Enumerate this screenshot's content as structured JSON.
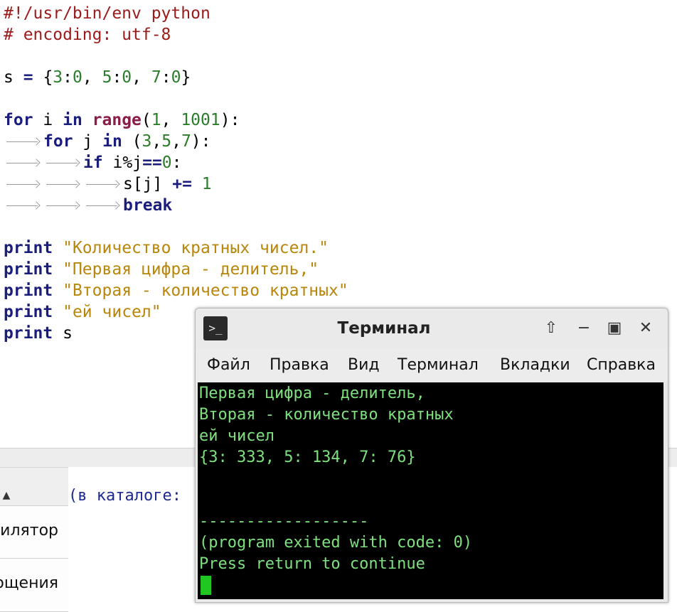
{
  "editor": {
    "lines": {
      "shebang": "#!/usr/bin/env python",
      "encoding": "# encoding: utf-8",
      "s_name": "s",
      "s_eq": "=",
      "s_open": "{",
      "s_k1": "3",
      "s_c1": ":",
      "s_v1": "0",
      "s_sep1": ", ",
      "s_k2": "5",
      "s_c2": ":",
      "s_v2": "0",
      "s_sep2": ", ",
      "s_k3": "7",
      "s_c3": ":",
      "s_v3": "0",
      "s_close": "}",
      "for1_kw": "for",
      "for1_var": " i ",
      "for1_in": "in",
      "for1_range": "range",
      "for1_open": "(",
      "for1_a": "1",
      "for1_sep": ", ",
      "for1_b": "1001",
      "for1_close": "):",
      "for2_kw": "for",
      "for2_var": " j ",
      "for2_in": "in",
      "for2_open": " (",
      "for2_a": "3",
      "for2_c1": ",",
      "for2_b": "5",
      "for2_c2": ",",
      "for2_c": "7",
      "for2_close": "):",
      "if_kw": "if",
      "if_expr": " i%j",
      "if_op": "==",
      "if_num": "0",
      "if_colon": ":",
      "inc_target": "s[j] ",
      "inc_op": "+=",
      "inc_num": " 1",
      "break_kw": "break",
      "print_kw": "print",
      "print1_str": "\"Количество кратных чисел.\"",
      "print2_str": "\"Первая цифра - делитель,\"",
      "print3_str": "\"Вторая - количество кратных\"",
      "print4_str": "\"ей чисел\"",
      "print5_arg": " s"
    }
  },
  "bottom_panel": {
    "side_tabs": [
      "илятор",
      "ощения"
    ],
    "compiler_text": "(в каталоге:"
  },
  "terminal": {
    "icon_text": ">_",
    "title": "Терминал",
    "buttons": {
      "up": "⇧",
      "minimize": "−",
      "maximize": "▣",
      "close": "✕"
    },
    "menu": [
      "Файл",
      "Правка",
      "Вид",
      "Терминал",
      "Вкладки",
      "Справка"
    ],
    "output": [
      "Первая цифра - делитель,",
      "Вторая - количество кратных",
      "ей чисел",
      "{3: 333, 5: 134, 7: 76}",
      "",
      "",
      "------------------",
      "(program exited with code: 0)",
      "Press return to continue"
    ]
  }
}
